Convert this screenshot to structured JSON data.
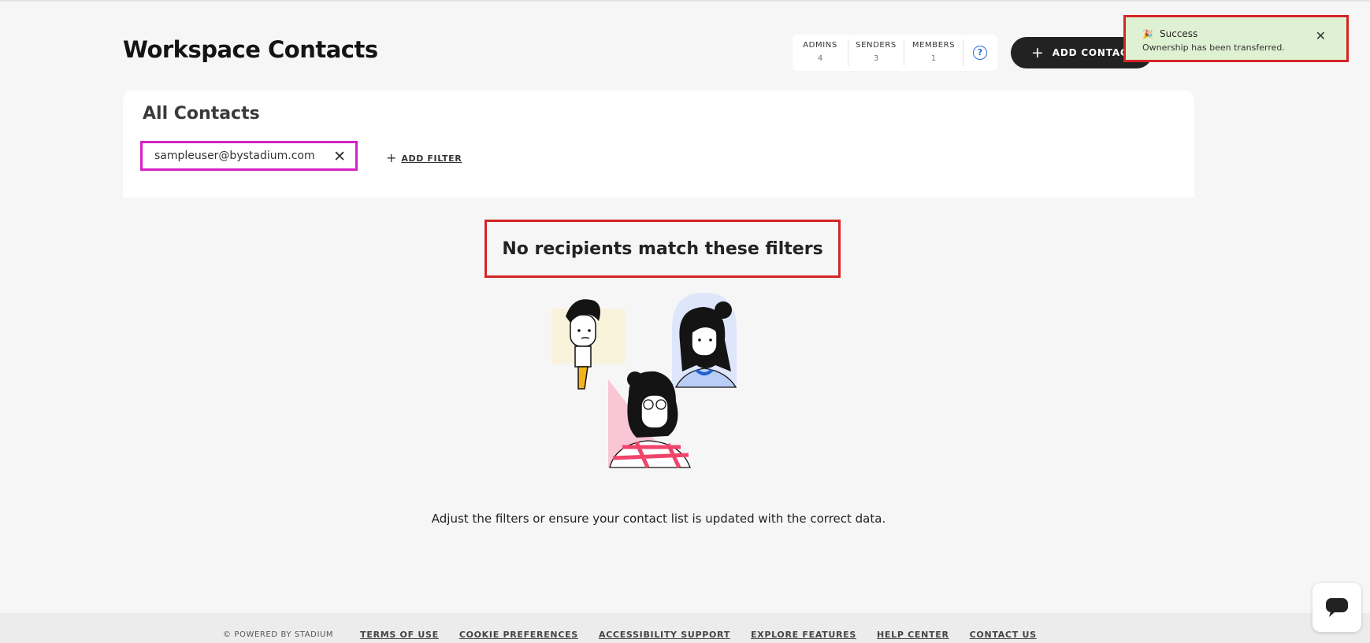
{
  "page": {
    "title": "Workspace Contacts"
  },
  "stats": [
    {
      "label": "ADMINS",
      "count": "4"
    },
    {
      "label": "SENDERS",
      "count": "3"
    },
    {
      "label": "MEMBERS",
      "count": "1"
    }
  ],
  "help": {
    "icon": "help-circle-icon",
    "glyph": "?"
  },
  "actions": {
    "add_contact": "ADD CONTACT",
    "plus_icon": "+"
  },
  "contacts_card": {
    "title": "All Contacts",
    "filter_chip": {
      "value": "sampleuser@bystadium.com",
      "close_glyph": "✕"
    },
    "add_filter": "ADD FILTER"
  },
  "empty_state": {
    "title": "No recipients match these filters",
    "description": "Adjust the filters or ensure your contact list is updated with the correct data."
  },
  "toast": {
    "icon": "party-popper-icon",
    "icon_glyph": "🎉",
    "title": "Success",
    "message": "Ownership has been transferred.",
    "close_glyph": "✕"
  },
  "footer": {
    "powered": "© POWERED BY STADIUM",
    "links": [
      "TERMS OF USE",
      "COOKIE PREFERENCES",
      "ACCESSIBILITY SUPPORT",
      "EXPLORE FEATURES",
      "HELP CENTER",
      "CONTACT US"
    ]
  },
  "colors": {
    "accent": "#2a6fd6",
    "dark_button": "#222222",
    "toast_bg": "#dff1d3",
    "highlight_red": "#d42525",
    "highlight_magenta": "#d621c6"
  }
}
